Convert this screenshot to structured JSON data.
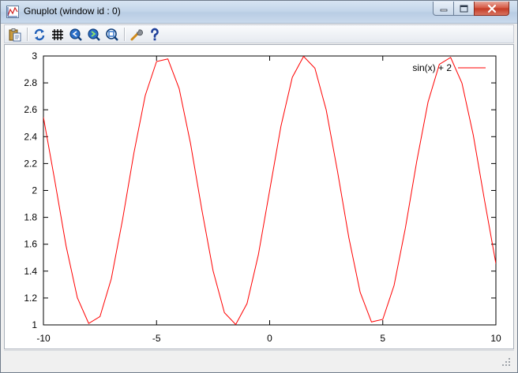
{
  "window": {
    "title": "Gnuplot (window id : 0)",
    "icon": "gnuplot-app-icon",
    "controls": [
      "minimize-icon",
      "maximize-icon",
      "close-icon"
    ]
  },
  "toolbar": {
    "items": [
      {
        "name": "copy-to-clipboard",
        "icon": "clipboard-icon"
      },
      {
        "name": "replot",
        "icon": "refresh-icon"
      },
      {
        "name": "toggle-grid",
        "icon": "grid-icon"
      },
      {
        "name": "zoom-previous",
        "icon": "zoom-previous-icon"
      },
      {
        "name": "zoom-next",
        "icon": "zoom-next-icon"
      },
      {
        "name": "autoscale",
        "icon": "autoscale-icon"
      },
      {
        "name": "options",
        "icon": "wrench-icon"
      },
      {
        "name": "help",
        "icon": "help-icon"
      }
    ]
  },
  "colors": {
    "series": "#ff0000",
    "axis": "#000000",
    "close_button": "#c43a24"
  },
  "chart_data": {
    "type": "line",
    "function": "sin(x) + 2",
    "x": [
      -10,
      -9.5,
      -9,
      -8.5,
      -8,
      -7.5,
      -7,
      -6.5,
      -6,
      -5.5,
      -5,
      -4.5,
      -4,
      -3.5,
      -3,
      -2.5,
      -2,
      -1.5,
      -1,
      -0.5,
      0,
      0.5,
      1,
      1.5,
      2,
      2.5,
      3,
      3.5,
      4,
      4.5,
      5,
      5.5,
      6,
      6.5,
      7,
      7.5,
      8,
      8.5,
      9,
      9.5,
      10
    ],
    "series": [
      {
        "name": "sin(x) + 2",
        "color": "#ff0000",
        "values": [
          2.544,
          2.075,
          1.588,
          1.202,
          1.011,
          1.062,
          1.343,
          1.785,
          2.279,
          2.706,
          2.959,
          2.978,
          2.757,
          2.351,
          1.859,
          1.402,
          1.091,
          1.003,
          1.159,
          1.521,
          2.0,
          2.479,
          2.841,
          2.997,
          2.909,
          2.598,
          2.141,
          1.649,
          1.243,
          1.022,
          1.041,
          1.294,
          1.721,
          2.215,
          2.657,
          2.938,
          2.989,
          2.798,
          2.412,
          1.925,
          1.456
        ]
      }
    ],
    "xlim": [
      -10,
      10
    ],
    "ylim": [
      1,
      3
    ],
    "xticks": [
      "-10",
      "-5",
      "0",
      "5",
      "10"
    ],
    "yticks": [
      "1",
      "1.2",
      "1.4",
      "1.6",
      "1.8",
      "2",
      "2.2",
      "2.4",
      "2.6",
      "2.8",
      "3"
    ],
    "legend": {
      "label": "sin(x) + 2",
      "position": "top-right"
    },
    "grid": false
  }
}
